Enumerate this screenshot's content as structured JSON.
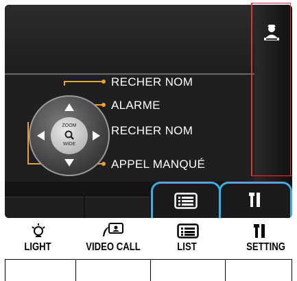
{
  "menu": {
    "items": [
      {
        "label": "RECHER NOM"
      },
      {
        "label": "ALARME"
      },
      {
        "label": "RECHER NOM"
      },
      {
        "label": "APPEL MANQUÉ"
      }
    ]
  },
  "dpad": {
    "zoom_label": "ZOOM",
    "wide_label": "WIDE"
  },
  "buttons": [
    {
      "label": "LIGHT",
      "icon": "light-bulb-icon"
    },
    {
      "label": "VIDEO CALL",
      "icon": "video-call-icon"
    },
    {
      "label": "LIST",
      "icon": "list-icon"
    },
    {
      "label": "SETTING",
      "icon": "tools-icon"
    }
  ],
  "colors": {
    "accent_orange": "#f0a030",
    "tab_highlight": "#3ab0e8",
    "frame_red": "#d43a3a"
  }
}
